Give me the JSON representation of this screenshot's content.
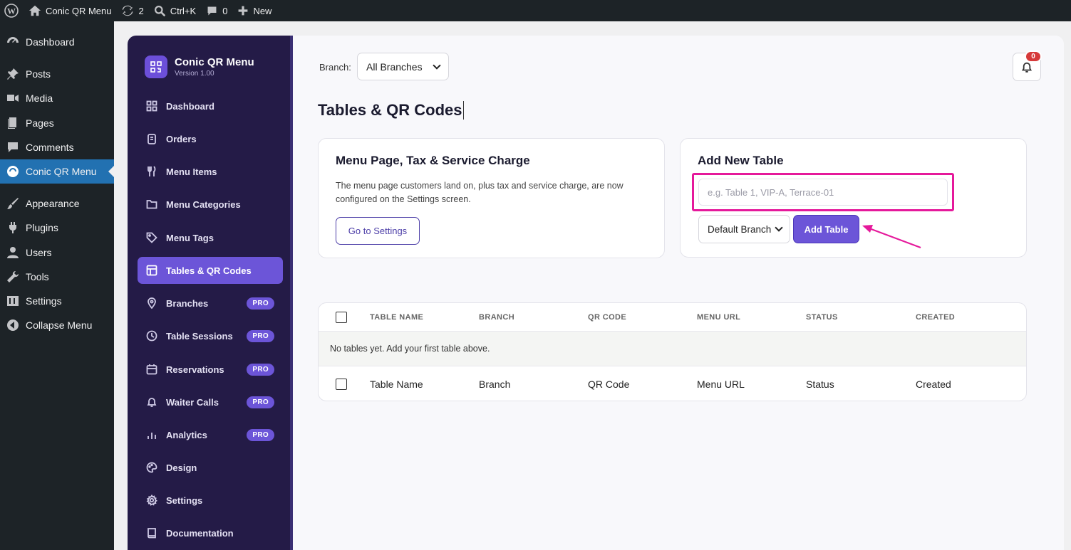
{
  "adminbar": {
    "site_name": "Conic QR Menu",
    "updates_count": "2",
    "search_shortcut": "Ctrl+K",
    "comments_count": "0",
    "new_label": "New"
  },
  "wpmenu": {
    "items": [
      {
        "label": "Dashboard",
        "icon": "dashboard-icon"
      },
      {
        "label": "Posts",
        "icon": "pin-icon"
      },
      {
        "label": "Media",
        "icon": "media-icon"
      },
      {
        "label": "Pages",
        "icon": "pages-icon"
      },
      {
        "label": "Comments",
        "icon": "comments-icon"
      },
      {
        "label": "Conic QR Menu",
        "icon": "plugin-icon",
        "active": true
      },
      {
        "label": "Appearance",
        "icon": "brush-icon"
      },
      {
        "label": "Plugins",
        "icon": "plug-icon"
      },
      {
        "label": "Users",
        "icon": "user-icon"
      },
      {
        "label": "Tools",
        "icon": "wrench-icon"
      },
      {
        "label": "Settings",
        "icon": "settings-icon"
      },
      {
        "label": "Collapse Menu",
        "icon": "collapse-icon"
      }
    ]
  },
  "plugin": {
    "title": "Conic QR Menu",
    "version": "Version 1.00",
    "nav": [
      {
        "label": "Dashboard",
        "icon": "grid-icon"
      },
      {
        "label": "Orders",
        "icon": "clipboard-icon"
      },
      {
        "label": "Menu Items",
        "icon": "cutlery-icon"
      },
      {
        "label": "Menu Categories",
        "icon": "folder-icon"
      },
      {
        "label": "Menu Tags",
        "icon": "tag-icon"
      },
      {
        "label": "Tables & QR Codes",
        "icon": "table-icon",
        "active": true
      },
      {
        "label": "Branches",
        "icon": "location-icon",
        "pro": "PRO"
      },
      {
        "label": "Table Sessions",
        "icon": "clock-icon",
        "pro": "PRO"
      },
      {
        "label": "Reservations",
        "icon": "calendar-icon",
        "pro": "PRO"
      },
      {
        "label": "Waiter Calls",
        "icon": "bell-icon",
        "pro": "PRO"
      },
      {
        "label": "Analytics",
        "icon": "bars-icon",
        "pro": "PRO"
      },
      {
        "label": "Design",
        "icon": "palette-icon"
      },
      {
        "label": "Settings",
        "icon": "gear-icon"
      },
      {
        "label": "Documentation",
        "icon": "book-icon"
      }
    ]
  },
  "content": {
    "branch_label": "Branch:",
    "branch_selected": "All Branches",
    "notification_count": "0",
    "page_title": "Tables & QR Codes",
    "settings_card": {
      "title": "Menu Page, Tax & Service Charge",
      "description": "The menu page customers land on, plus tax and service charge, are now configured on the Settings screen.",
      "button": "Go to Settings"
    },
    "add_card": {
      "title": "Add New Table",
      "input_placeholder": "e.g. Table 1, VIP-A, Terrace-01",
      "branch_selected": "Default Branch",
      "button": "Add Table"
    },
    "table": {
      "headers": [
        "TABLE NAME",
        "BRANCH",
        "QR CODE",
        "MENU URL",
        "STATUS",
        "CREATED"
      ],
      "empty_message": "No tables yet. Add your first table above.",
      "footers": [
        "Table Name",
        "Branch",
        "QR Code",
        "Menu URL",
        "Status",
        "Created"
      ]
    }
  },
  "colors": {
    "accent": "#6c55d8",
    "sidebar": "#241b47",
    "highlight": "#e5199b"
  }
}
